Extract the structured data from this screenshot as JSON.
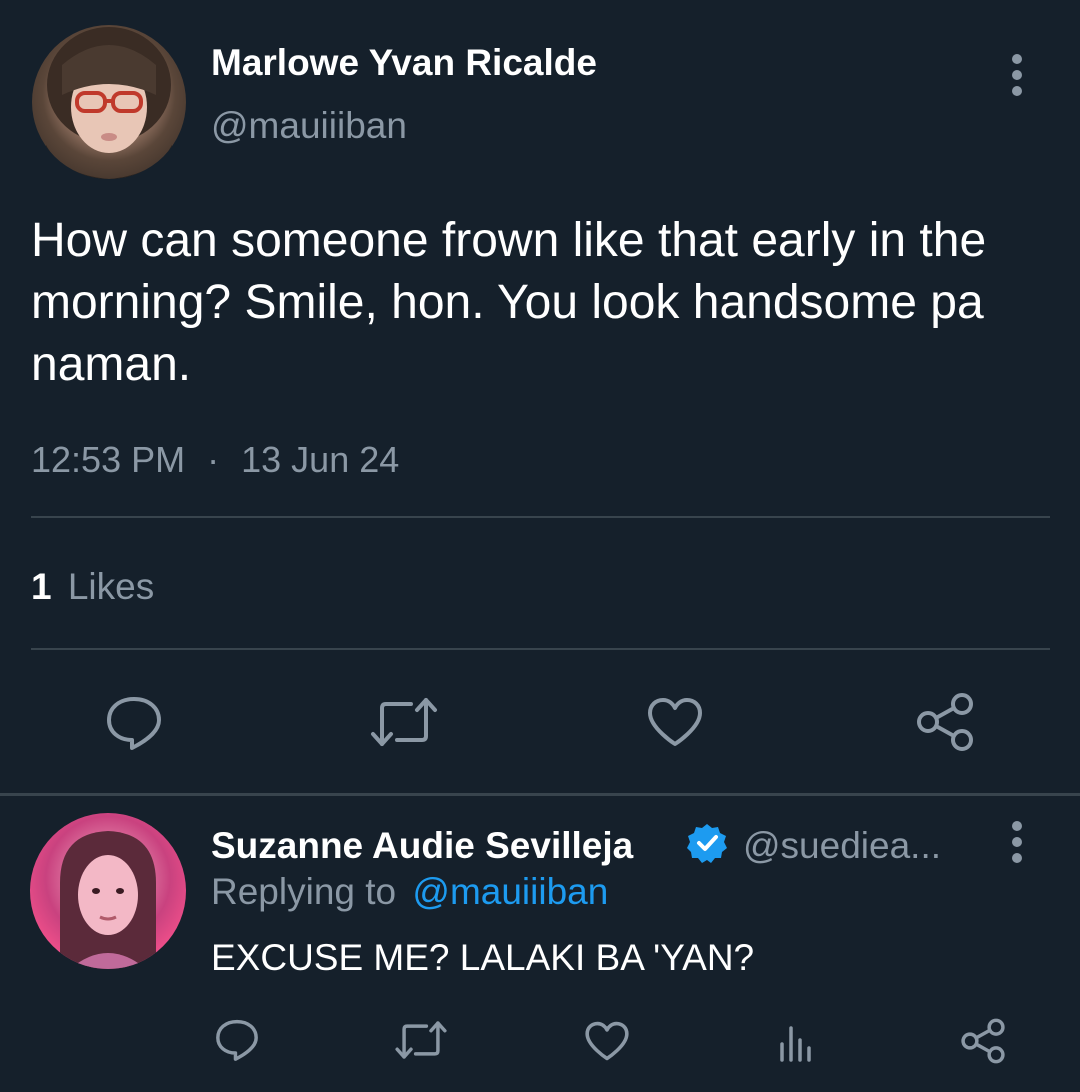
{
  "tweet": {
    "author": {
      "name": "Marlowe Yvan Ricalde",
      "handle": "@mauiiiban",
      "avatar_icon": "user-avatar-photo"
    },
    "text": "How can someone frown like that early in the morning? Smile, hon. You look handsome pa naman.",
    "time": "12:53 PM",
    "separator": "·",
    "date": "13 Jun 24",
    "likes_count": "1",
    "likes_label": "Likes",
    "actions": [
      "reply-icon",
      "retweet-icon",
      "like-icon",
      "share-icon"
    ]
  },
  "reply": {
    "author": {
      "name": "Suzanne Audie Sevilleja",
      "handle": "@suediea...",
      "verified": true,
      "avatar_icon": "user-avatar-photo"
    },
    "replying_prefix": "Replying to",
    "replying_to": "@mauiiiban",
    "text": "EXCUSE ME? LALAKI BA 'YAN?",
    "actions": [
      "reply-icon",
      "retweet-icon",
      "like-icon",
      "views-icon",
      "share-icon"
    ]
  },
  "colors": {
    "background": "#15202b",
    "secondary_text": "#8b98a5",
    "divider": "#38444d",
    "accent": "#1d9bf0"
  }
}
